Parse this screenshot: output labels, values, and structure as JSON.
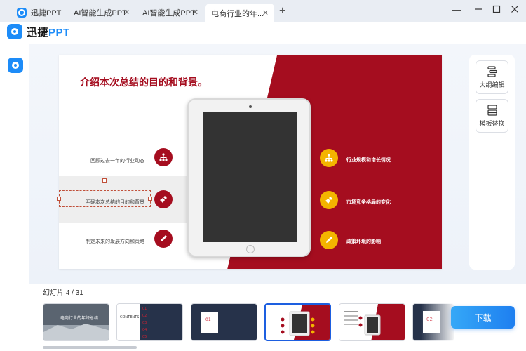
{
  "tabs": [
    {
      "label": "迅捷PPT",
      "active": false,
      "has_logo": true
    },
    {
      "label": "AI智能生成PPT",
      "active": false
    },
    {
      "label": "AI智能生成PPT",
      "active": false
    },
    {
      "label": "电商行业的年...",
      "active": true
    }
  ],
  "window": {
    "minimize": "—",
    "maximize": "☐",
    "close": "✕",
    "new_tab": "+"
  },
  "brand": {
    "name_cn": "迅捷",
    "name_en": "PPT"
  },
  "slide": {
    "title": "介绍本次总结的目的和背景。",
    "left_items": [
      "回顾过去一年的行业动态",
      "明确本次总结的目的和背景",
      "制定未来的发展方向和策略"
    ],
    "right_items": [
      "行业规模和增长情况",
      "市场竞争格局的变化",
      "政策环境的影响"
    ]
  },
  "tools": [
    {
      "label": "大纲编辑",
      "icon": "outline-edit-icon"
    },
    {
      "label": "模板替换",
      "icon": "template-replace-icon"
    }
  ],
  "slide_counter": "幻灯片 4 / 31",
  "thumbnails": [
    {
      "title": "电商行业的年终总结"
    },
    {
      "title": "CONTENTS"
    },
    {
      "title": "01"
    },
    {
      "title": ""
    },
    {
      "title": ""
    },
    {
      "title": "02"
    }
  ],
  "download_label": "下载",
  "colors": {
    "accent": "#1d8cf8",
    "slide_red": "#a50d1f",
    "slide_yellow": "#f4b400",
    "download": "#1e7ff0"
  }
}
